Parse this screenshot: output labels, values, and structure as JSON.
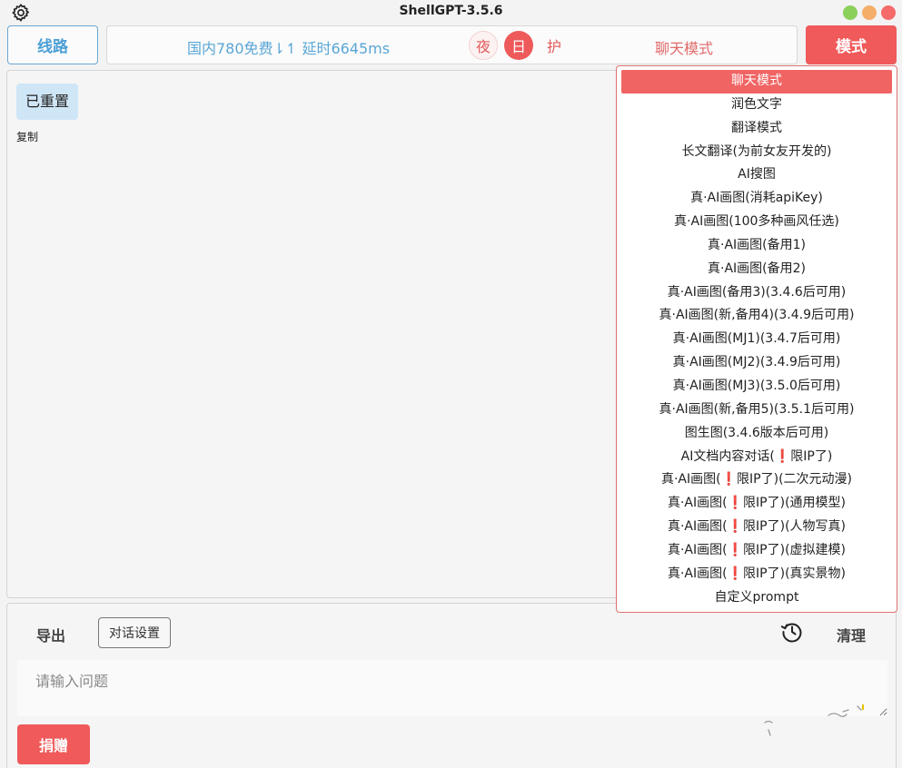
{
  "titlebar": {
    "title": "ShellGPT-3.5.6"
  },
  "toolbar": {
    "route_label": "线路",
    "status_text": "国内780免费⇂↿ 延时6645ms",
    "theme_night": "夜",
    "theme_day": "日",
    "theme_eye": "护",
    "current_mode": "聊天模式",
    "mode_button": "模式"
  },
  "chat": {
    "message": "已重置",
    "copy_label": "复制"
  },
  "bottom": {
    "export_label": "导出",
    "settings_label": "对话设置",
    "clear_label": "清理",
    "input_placeholder": "请输入问题",
    "donate_label": "捐赠"
  },
  "mode_menu": {
    "items": [
      "聊天模式",
      "润色文字",
      "翻译模式",
      "长文翻译(为前女友开发的)",
      "AI搜图",
      "真·AI画图(消耗apiKey)",
      "真·AI画图(100多种画风任选)",
      "真·AI画图(备用1)",
      "真·AI画图(备用2)",
      "真·AI画图(备用3)(3.4.6后可用)",
      "真·AI画图(新,备用4)(3.4.9后可用)",
      "真·AI画图(MJ1)(3.4.7后可用)",
      "真·AI画图(MJ2)(3.4.9后可用)",
      "真·AI画图(MJ3)(3.5.0后可用)",
      "真·AI画图(新,备用5)(3.5.1后可用)",
      "图生图(3.4.6版本后可用)",
      "AI文档内容对话(❗限IP了)",
      "真·AI画图(❗限IP了)(二次元动漫)",
      "真·AI画图(❗限IP了)(通用模型)",
      "真·AI画图(❗限IP了)(人物写真)",
      "真·AI画图(❗限IP了)(虚拟建模)",
      "真·AI画图(❗限IP了)(真实景物)",
      "自定义prompt"
    ],
    "selected_index": 0
  },
  "colors": {
    "accent_red": "#f05a5a",
    "accent_blue": "#4a9fd6",
    "bubble_blue": "#cfe6f7"
  }
}
